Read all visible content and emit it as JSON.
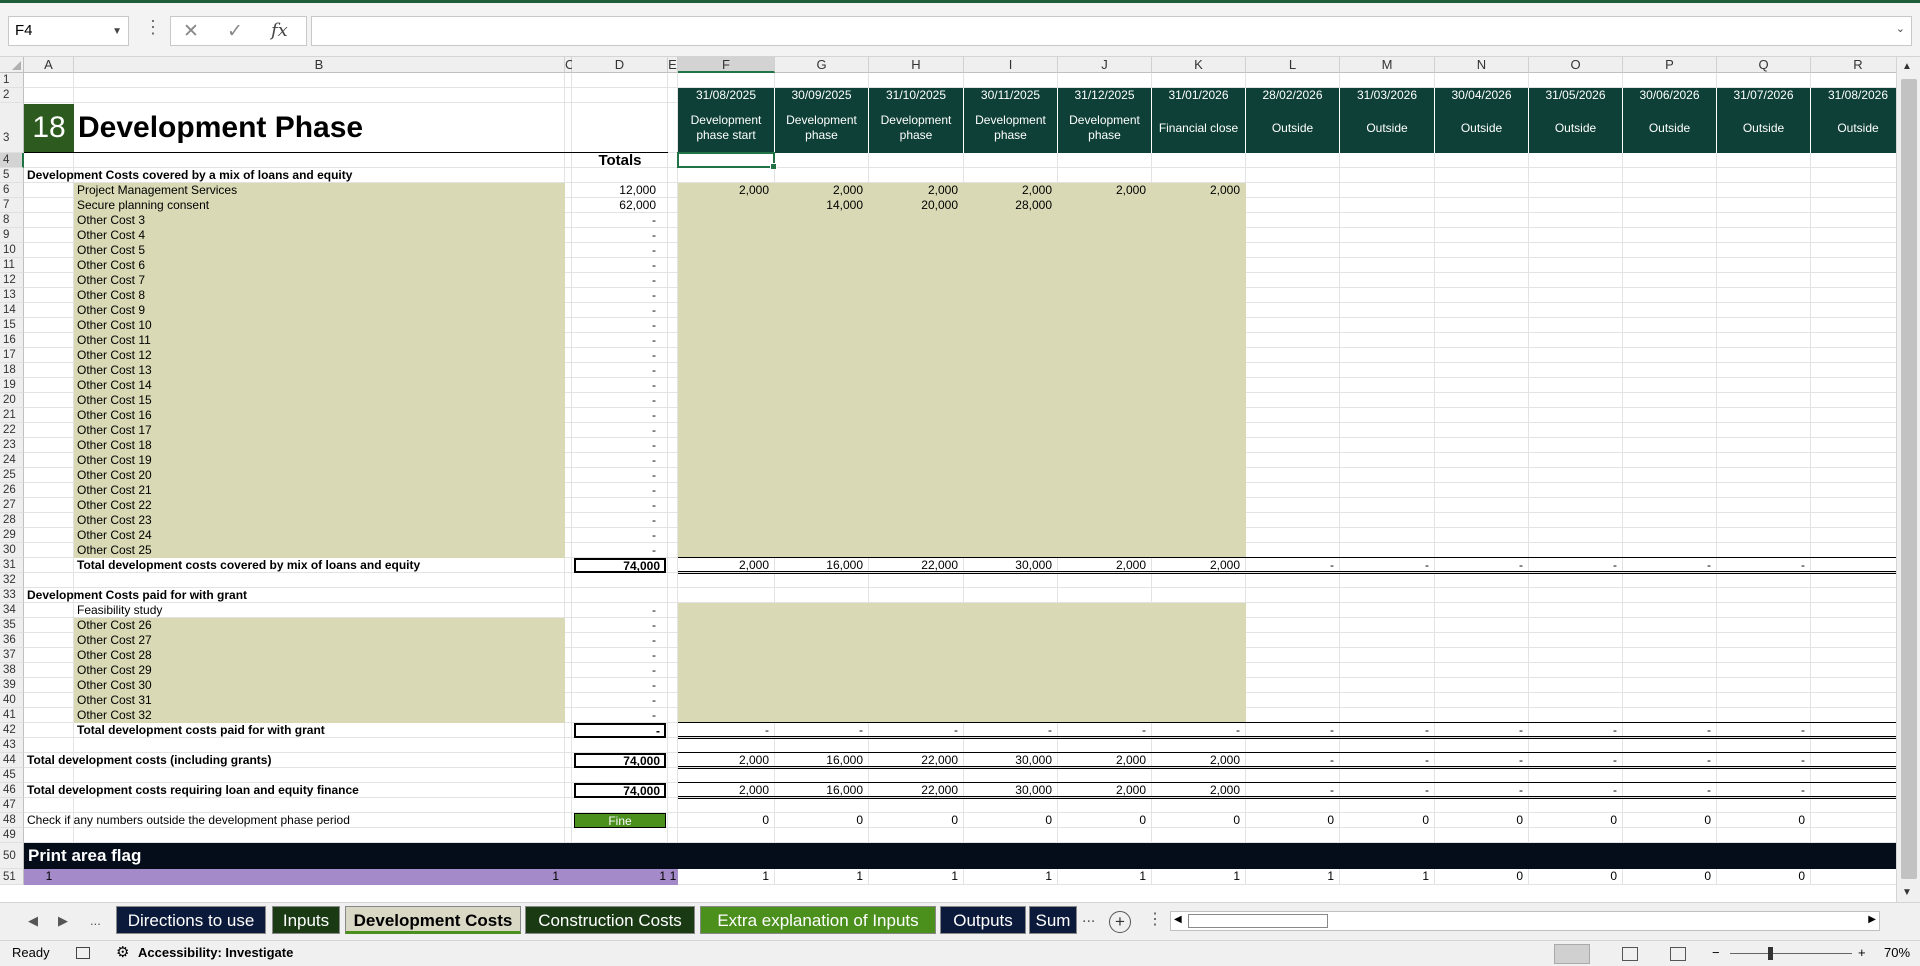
{
  "formula_bar": {
    "name_box": "F4",
    "formula": "",
    "fx_label": "fx"
  },
  "columns": [
    "A",
    "B",
    "C",
    "D",
    "E",
    "F",
    "G",
    "H",
    "I",
    "J",
    "K",
    "L",
    "M",
    "N",
    "O",
    "P",
    "Q",
    "R"
  ],
  "rows": [
    "1",
    "2",
    "3",
    "4",
    "5",
    "6",
    "7",
    "8",
    "9",
    "10",
    "11",
    "12",
    "13",
    "14",
    "15",
    "16",
    "17",
    "18",
    "19",
    "20",
    "21",
    "22",
    "23",
    "24",
    "25",
    "26",
    "27",
    "28",
    "29",
    "30",
    "31",
    "32",
    "33",
    "34",
    "35",
    "36",
    "37",
    "38",
    "39",
    "40",
    "41",
    "42",
    "43",
    "44",
    "45",
    "46",
    "47",
    "48",
    "49",
    "50",
    "51"
  ],
  "header": {
    "section_number": "18",
    "section_title": "Development Phase",
    "totals_label": "Totals",
    "dates": [
      "31/08/2025",
      "30/09/2025",
      "31/10/2025",
      "30/11/2025",
      "31/12/2025",
      "31/01/2026",
      "28/02/2026",
      "31/03/2026",
      "30/04/2026",
      "31/05/2026",
      "30/06/2026",
      "31/07/2026",
      "31/08/2026"
    ],
    "phases": [
      "Development phase start",
      "Development phase",
      "Development phase",
      "Development phase",
      "Development phase",
      "Financial close",
      "Outside",
      "Outside",
      "Outside",
      "Outside",
      "Outside",
      "Outside",
      "Outside"
    ]
  },
  "section1": {
    "title": "Development Costs covered by a mix of loans and equity",
    "items": [
      {
        "label": "Project Management Services",
        "total": "12,000",
        "vals": [
          "2,000",
          "2,000",
          "2,000",
          "2,000",
          "2,000",
          "2,000"
        ]
      },
      {
        "label": "Secure planning consent",
        "total": "62,000",
        "vals": [
          "",
          "14,000",
          "20,000",
          "28,000",
          "",
          ""
        ]
      },
      {
        "label": "Other Cost 3",
        "total": "-"
      },
      {
        "label": "Other Cost 4",
        "total": "-"
      },
      {
        "label": "Other Cost 5",
        "total": "-"
      },
      {
        "label": "Other Cost 6",
        "total": "-"
      },
      {
        "label": "Other Cost 7",
        "total": "-"
      },
      {
        "label": "Other Cost 8",
        "total": "-"
      },
      {
        "label": "Other Cost 9",
        "total": "-"
      },
      {
        "label": "Other Cost 10",
        "total": "-"
      },
      {
        "label": "Other Cost 11",
        "total": "-"
      },
      {
        "label": "Other Cost 12",
        "total": "-"
      },
      {
        "label": "Other Cost 13",
        "total": "-"
      },
      {
        "label": "Other Cost 14",
        "total": "-"
      },
      {
        "label": "Other Cost 15",
        "total": "-"
      },
      {
        "label": "Other Cost 16",
        "total": "-"
      },
      {
        "label": "Other Cost 17",
        "total": "-"
      },
      {
        "label": "Other Cost 18",
        "total": "-"
      },
      {
        "label": "Other Cost 19",
        "total": "-"
      },
      {
        "label": "Other Cost 20",
        "total": "-"
      },
      {
        "label": "Other Cost 21",
        "total": "-"
      },
      {
        "label": "Other Cost 22",
        "total": "-"
      },
      {
        "label": "Other Cost 23",
        "total": "-"
      },
      {
        "label": "Other Cost 24",
        "total": "-"
      },
      {
        "label": "Other Cost 25",
        "total": "-"
      }
    ],
    "total_label": "Total development costs covered by mix of loans and equity",
    "total_value": "74,000",
    "total_row": [
      "2,000",
      "16,000",
      "22,000",
      "30,000",
      "2,000",
      "2,000",
      "-",
      "-",
      "-",
      "-",
      "-",
      "-",
      "-"
    ]
  },
  "section2": {
    "title": "Development Costs paid for with grant",
    "items": [
      {
        "label": "Feasibility study",
        "total": "-"
      },
      {
        "label": "Other Cost 26",
        "total": "-"
      },
      {
        "label": "Other Cost 27",
        "total": "-"
      },
      {
        "label": "Other Cost 28",
        "total": "-"
      },
      {
        "label": "Other Cost 29",
        "total": "-"
      },
      {
        "label": "Other Cost 30",
        "total": "-"
      },
      {
        "label": "Other Cost 31",
        "total": "-"
      },
      {
        "label": "Other Cost 32",
        "total": "-"
      }
    ],
    "total_label": "Total development costs paid for with grant",
    "total_value": "-",
    "total_row": [
      "-",
      "-",
      "-",
      "-",
      "-",
      "-",
      "-",
      "-",
      "-",
      "-",
      "-",
      "-",
      "-"
    ]
  },
  "total_including_grants": {
    "label": "Total development costs (including grants)",
    "value": "74,000",
    "row": [
      "2,000",
      "16,000",
      "22,000",
      "30,000",
      "2,000",
      "2,000",
      "-",
      "-",
      "-",
      "-",
      "-",
      "-",
      "-"
    ]
  },
  "total_loan_equity": {
    "label": "Total development costs requiring loan and equity finance",
    "value": "74,000",
    "row": [
      "2,000",
      "16,000",
      "22,000",
      "30,000",
      "2,000",
      "2,000",
      "-",
      "-",
      "-",
      "-",
      "-",
      "-",
      "-"
    ]
  },
  "check": {
    "label": "Check if any numbers outside the development phase period",
    "status": "Fine",
    "status_color": "#4b8f1d",
    "row": [
      "0",
      "0",
      "0",
      "0",
      "0",
      "0",
      "0",
      "0",
      "0",
      "0",
      "0",
      "0",
      ""
    ]
  },
  "print_area": {
    "title": "Print area flag",
    "a_value": "1",
    "b_value": "1",
    "d_value": "1",
    "e_value": "1",
    "row": [
      "1",
      "1",
      "1",
      "1",
      "1",
      "1",
      "1",
      "1",
      "0",
      "0",
      "0",
      "0",
      ""
    ]
  },
  "tabs": [
    {
      "label": "Directions to use",
      "color": "#0b1a3a",
      "active": false
    },
    {
      "label": "Inputs",
      "color": "#1a3a14",
      "active": false
    },
    {
      "label": "Development Costs",
      "color": "#d8d8c4",
      "active": true
    },
    {
      "label": "Construction Costs",
      "color": "#1a3a14",
      "active": false
    },
    {
      "label": "Extra explanation of Inputs",
      "color": "#4b8f1d",
      "active": false
    },
    {
      "label": "Outputs",
      "color": "#0b1a3a",
      "active": false
    },
    {
      "label": "Sum",
      "color": "#0b1a3a",
      "active": false
    }
  ],
  "tab_more": "...",
  "tab_nav_more": "...",
  "status": {
    "ready": "Ready",
    "accessibility": "Accessibility: Investigate",
    "zoom": "70%"
  },
  "colors": {
    "dark_green": "#0e4037",
    "khaki": "#d9d9b5",
    "section_green": "#2d5a1e",
    "print_band": "#050d1a",
    "purple": "#a48ac8"
  }
}
